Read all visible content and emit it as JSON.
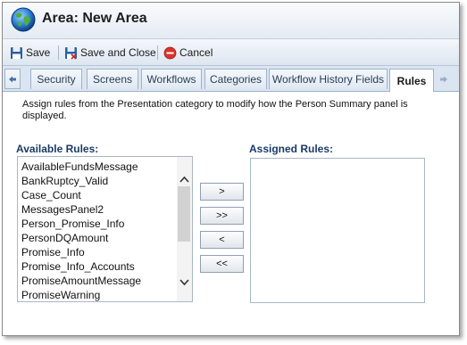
{
  "window": {
    "title": "Area: New Area"
  },
  "toolbar": {
    "save_label": "Save",
    "save_close_label": "Save and Close",
    "cancel_label": "Cancel"
  },
  "tabs": [
    {
      "label": "Security",
      "active": false
    },
    {
      "label": "Screens",
      "active": false
    },
    {
      "label": "Workflows",
      "active": false
    },
    {
      "label": "Categories",
      "active": false
    },
    {
      "label": "Workflow History Fields",
      "active": false
    },
    {
      "label": "Rules",
      "active": true
    }
  ],
  "description": "Assign rules from the Presentation category to modify how the Person Summary panel is displayed.",
  "available": {
    "label": "Available Rules:",
    "items": [
      "AvailableFundsMessage",
      "BankRuptcy_Valid",
      "Case_Count",
      "MessagesPanel2",
      "Person_Promise_Info",
      "PersonDQAmount",
      "Promise_Info",
      "Promise_Info_Accounts",
      "PromiseAmountMessage",
      "PromiseWarning"
    ]
  },
  "assigned": {
    "label": "Assigned Rules:",
    "items": []
  },
  "buttons": {
    "add": ">",
    "add_all": ">>",
    "remove": "<",
    "remove_all": "<<"
  },
  "colors": {
    "accent": "#1a3a66",
    "tab_border": "#9cb3cd",
    "cancel_red": "#d9342b"
  }
}
